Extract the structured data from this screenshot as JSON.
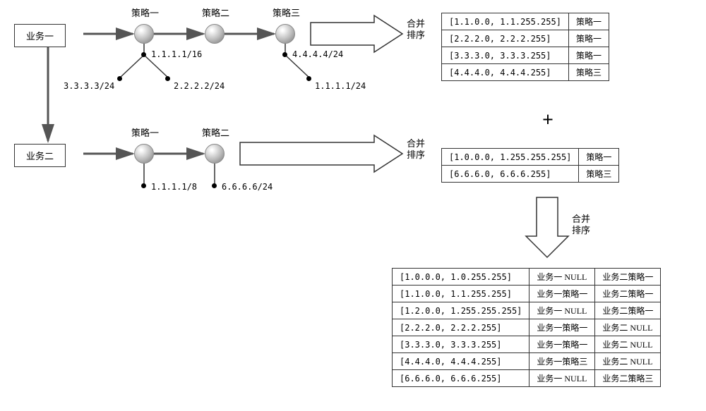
{
  "business1": {
    "label": "业务一"
  },
  "business2": {
    "label": "业务二"
  },
  "strategy_labels": {
    "s1": "策略一",
    "s2": "策略二",
    "s3": "策略三"
  },
  "merge_sort": {
    "line1": "合并",
    "line2": "排序"
  },
  "ips": {
    "b1_s1_a": "3.3.3.3/24",
    "b1_s1_b": "1.1.1.1/16",
    "b1_s1_c": "2.2.2.2/24",
    "b1_s3_a": "4.4.4.4/24",
    "b1_s3_b": "1.1.1.1/24",
    "b2_s1_a": "1.1.1.1/8",
    "b2_s2_a": "6.6.6.6/24"
  },
  "table1": {
    "rows": [
      {
        "range": "[1.1.0.0, 1.1.255.255]",
        "strat": "策略一"
      },
      {
        "range": "[2.2.2.0, 2.2.2.255]",
        "strat": "策略一"
      },
      {
        "range": "[3.3.3.0, 3.3.3.255]",
        "strat": "策略一"
      },
      {
        "range": "[4.4.4.0, 4.4.4.255]",
        "strat": "策略三"
      }
    ]
  },
  "table2": {
    "rows": [
      {
        "range": "[1.0.0.0, 1.255.255.255]",
        "strat": "策略一"
      },
      {
        "range": "[6.6.6.0, 6.6.6.255]",
        "strat": "策略三"
      }
    ]
  },
  "table3": {
    "rows": [
      {
        "range": "[1.0.0.0, 1.0.255.255]",
        "c1": "业务一 NULL",
        "c2": "业务二策略一"
      },
      {
        "range": "[1.1.0.0, 1.1.255.255]",
        "c1": "业务一策略一",
        "c2": "业务二策略一"
      },
      {
        "range": "[1.2.0.0, 1.255.255.255]",
        "c1": "业务一 NULL",
        "c2": "业务二策略一"
      },
      {
        "range": "[2.2.2.0, 2.2.2.255]",
        "c1": "业务一策略一",
        "c2": "业务二 NULL"
      },
      {
        "range": "[3.3.3.0, 3.3.3.255]",
        "c1": "业务一策略一",
        "c2": "业务二 NULL"
      },
      {
        "range": "[4.4.4.0, 4.4.4.255]",
        "c1": "业务一策略三",
        "c2": "业务二 NULL"
      },
      {
        "range": "[6.6.6.0, 6.6.6.255]",
        "c1": "业务一 NULL",
        "c2": "业务二策略三"
      }
    ]
  },
  "plus": "+"
}
